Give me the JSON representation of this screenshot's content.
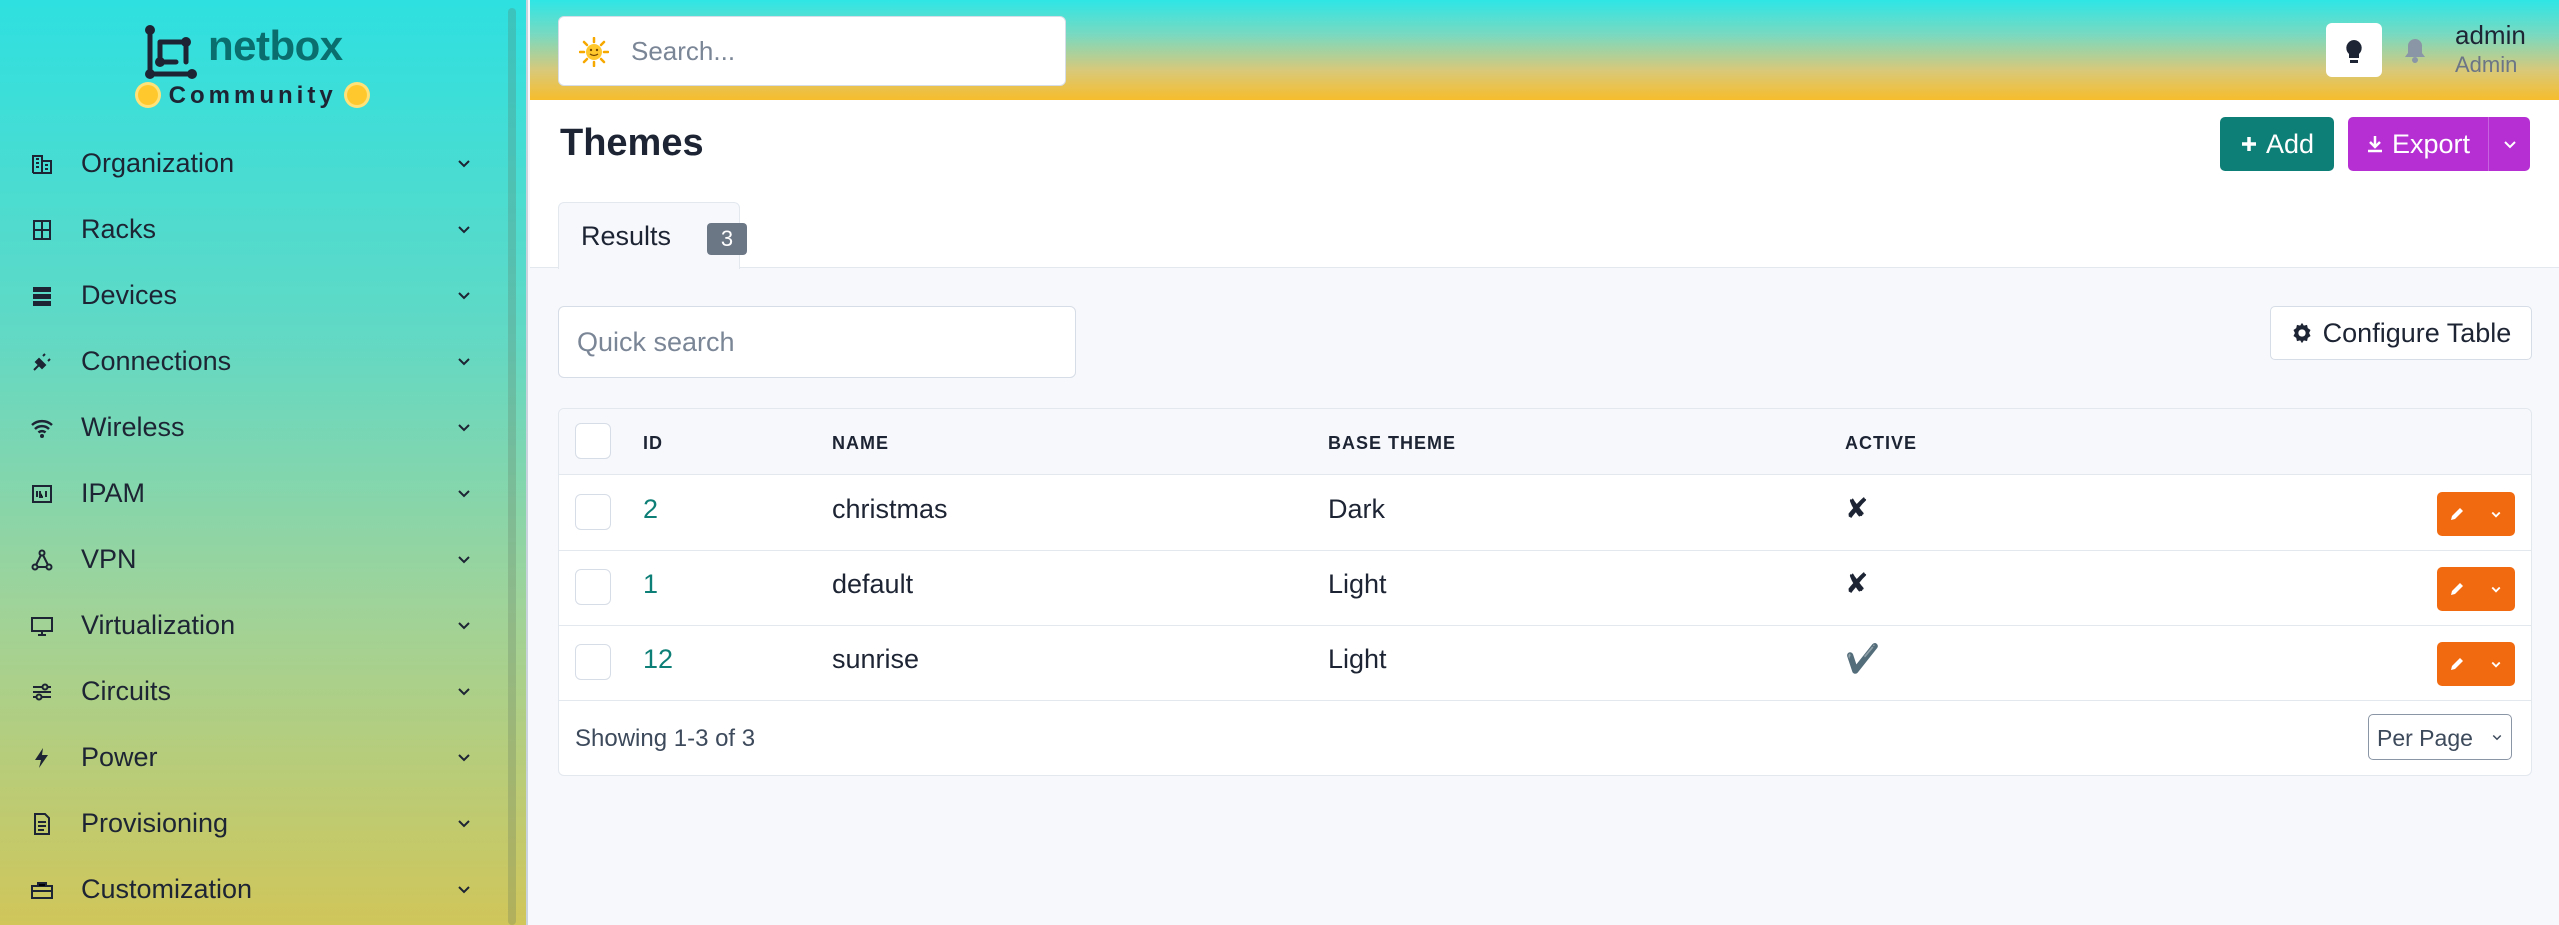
{
  "brand": {
    "name": "netbox",
    "subtitle": "Community"
  },
  "sidebar": {
    "items": [
      {
        "label": "Organization",
        "icon": "building-icon"
      },
      {
        "label": "Racks",
        "icon": "rack-icon"
      },
      {
        "label": "Devices",
        "icon": "server-icon"
      },
      {
        "label": "Connections",
        "icon": "plug-icon"
      },
      {
        "label": "Wireless",
        "icon": "wifi-icon"
      },
      {
        "label": "IPAM",
        "icon": "ipam-icon"
      },
      {
        "label": "VPN",
        "icon": "vpn-icon"
      },
      {
        "label": "Virtualization",
        "icon": "monitor-icon"
      },
      {
        "label": "Circuits",
        "icon": "circuit-icon"
      },
      {
        "label": "Power",
        "icon": "lightning-icon"
      },
      {
        "label": "Provisioning",
        "icon": "document-icon"
      },
      {
        "label": "Customization",
        "icon": "toolbox-icon"
      }
    ]
  },
  "header": {
    "search_placeholder": "Search...",
    "user_name": "admin",
    "user_role": "Admin"
  },
  "page": {
    "title": "Themes",
    "add_label": "Add",
    "export_label": "Export",
    "tab_label": "Results",
    "tab_count": "3"
  },
  "toolbar": {
    "quick_search_placeholder": "Quick search",
    "configure_label": "Configure Table"
  },
  "table": {
    "columns": [
      "ID",
      "NAME",
      "BASE THEME",
      "ACTIVE"
    ],
    "rows": [
      {
        "id": "2",
        "name": "christmas",
        "base_theme": "Dark",
        "active": "✘"
      },
      {
        "id": "1",
        "name": "default",
        "base_theme": "Light",
        "active": "✘"
      },
      {
        "id": "12",
        "name": "sunrise",
        "base_theme": "Light",
        "active": "✔️"
      }
    ],
    "showing": "Showing 1-3 of 3",
    "per_page_label": "Per Page"
  },
  "colors": {
    "accent_teal": "#0e7f76",
    "export_purple": "#b52fd3",
    "action_orange": "#f26a0f"
  }
}
